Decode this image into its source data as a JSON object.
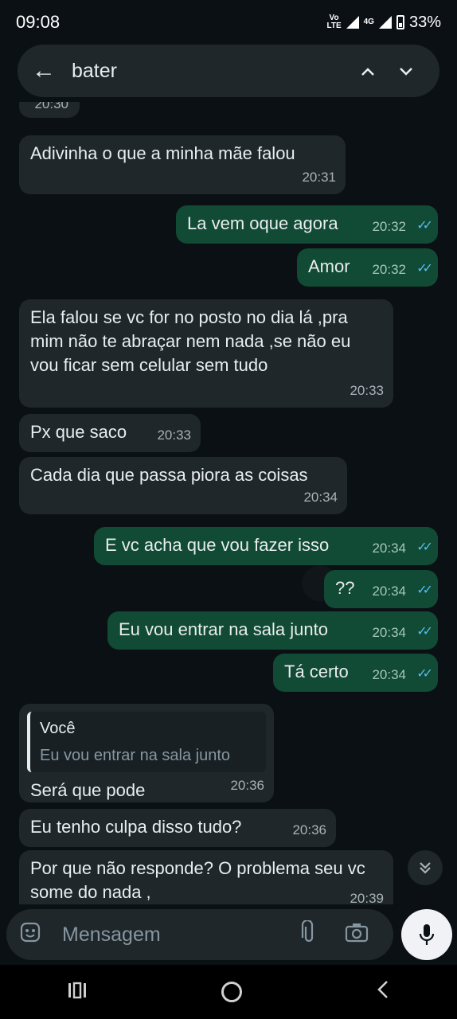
{
  "status_bar": {
    "time": "09:08",
    "lte": "Vo LTE",
    "net": "4G",
    "battery": "33%"
  },
  "search": {
    "query": "bater",
    "up": "⌃",
    "down": "⌄",
    "back": "←"
  },
  "messages": [
    {
      "text": "20:30",
      "type": "time-only"
    },
    {
      "text": "Adivinha o que a minha mãe falou",
      "time": "20:31",
      "dir": "in"
    },
    {
      "text": "La vem oque agora",
      "time": "20:32",
      "dir": "out"
    },
    {
      "text": "Amor",
      "time": "20:32",
      "dir": "out"
    },
    {
      "text": "Ela falou se vc for no posto no dia lá ,pra mim não te abraçar nem nada ,se não eu vou ficar sem celular sem tudo",
      "time": "20:33",
      "dir": "in"
    },
    {
      "text": "Px que saco",
      "time": "20:33",
      "dir": "in"
    },
    {
      "text": "Cada dia que passa piora as coisas",
      "time": "20:34",
      "dir": "in"
    },
    {
      "text": "E vc acha que vou fazer isso",
      "time": "20:34",
      "dir": "out"
    },
    {
      "text": "??",
      "time": "20:34",
      "dir": "out"
    },
    {
      "text": "Eu vou entrar na sala junto",
      "time": "20:34",
      "dir": "out"
    },
    {
      "text": "Tá certo",
      "time": "20:34",
      "dir": "out"
    },
    {
      "quote_author": "Você",
      "quote_text": "Eu vou entrar na sala junto",
      "text": "Será que pode",
      "time": "20:36",
      "dir": "in"
    },
    {
      "text": "Eu tenho culpa disso tudo?",
      "time": "20:36",
      "dir": "in"
    },
    {
      "text": "Por que não responde? O problema seu vc some do nada ,",
      "time": "20:39",
      "dir": "in"
    }
  ],
  "composer": {
    "placeholder": "Mensagem"
  }
}
